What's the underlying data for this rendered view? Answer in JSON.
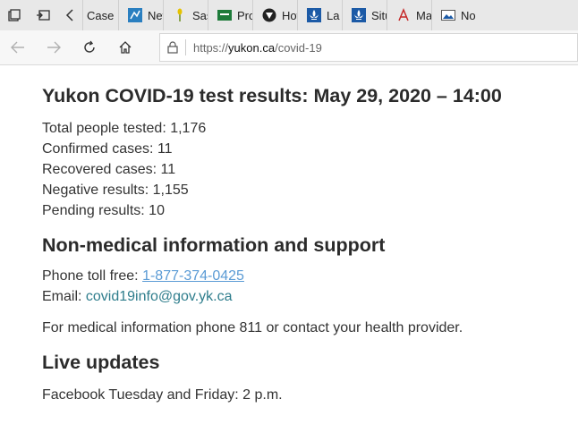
{
  "tabs": [
    {
      "title": "",
      "icon": "folder-tab-icon"
    },
    {
      "title": "Case",
      "icon": "page-icon"
    },
    {
      "title": "New",
      "icon": "chart-icon"
    },
    {
      "title": "Sask",
      "icon": "wheat-icon"
    },
    {
      "title": "Prov",
      "icon": "flag-icon"
    },
    {
      "title": "How",
      "icon": "shield-icon"
    },
    {
      "title": "La m",
      "icon": "fleur-de-lis-icon"
    },
    {
      "title": "Situ",
      "icon": "fleur-de-lis-icon"
    },
    {
      "title": "Map",
      "icon": "map-icon"
    },
    {
      "title": "No",
      "icon": "image-icon"
    }
  ],
  "address": {
    "url_prefix": "https://",
    "domain": "yukon.ca",
    "path": "/covid-19"
  },
  "page": {
    "title": "Yukon COVID-19 test results: May 29, 2020 – 14:00",
    "stats": [
      "Total people tested: 1,176",
      "Confirmed cases: 11",
      "Recovered cases: 11",
      "Negative results: 1,155",
      "Pending results: 10"
    ],
    "support_heading": "Non-medical information and support",
    "phone_label": "Phone toll free: ",
    "phone_number": "1-877-374-0425",
    "email_label": "Email: ",
    "email": "covid19info@gov.yk.ca",
    "medical_note": "For medical information phone 811 or contact your health provider.",
    "live_heading": "Live updates",
    "facebook": "Facebook Tuesday and Friday: 2 p.m."
  }
}
